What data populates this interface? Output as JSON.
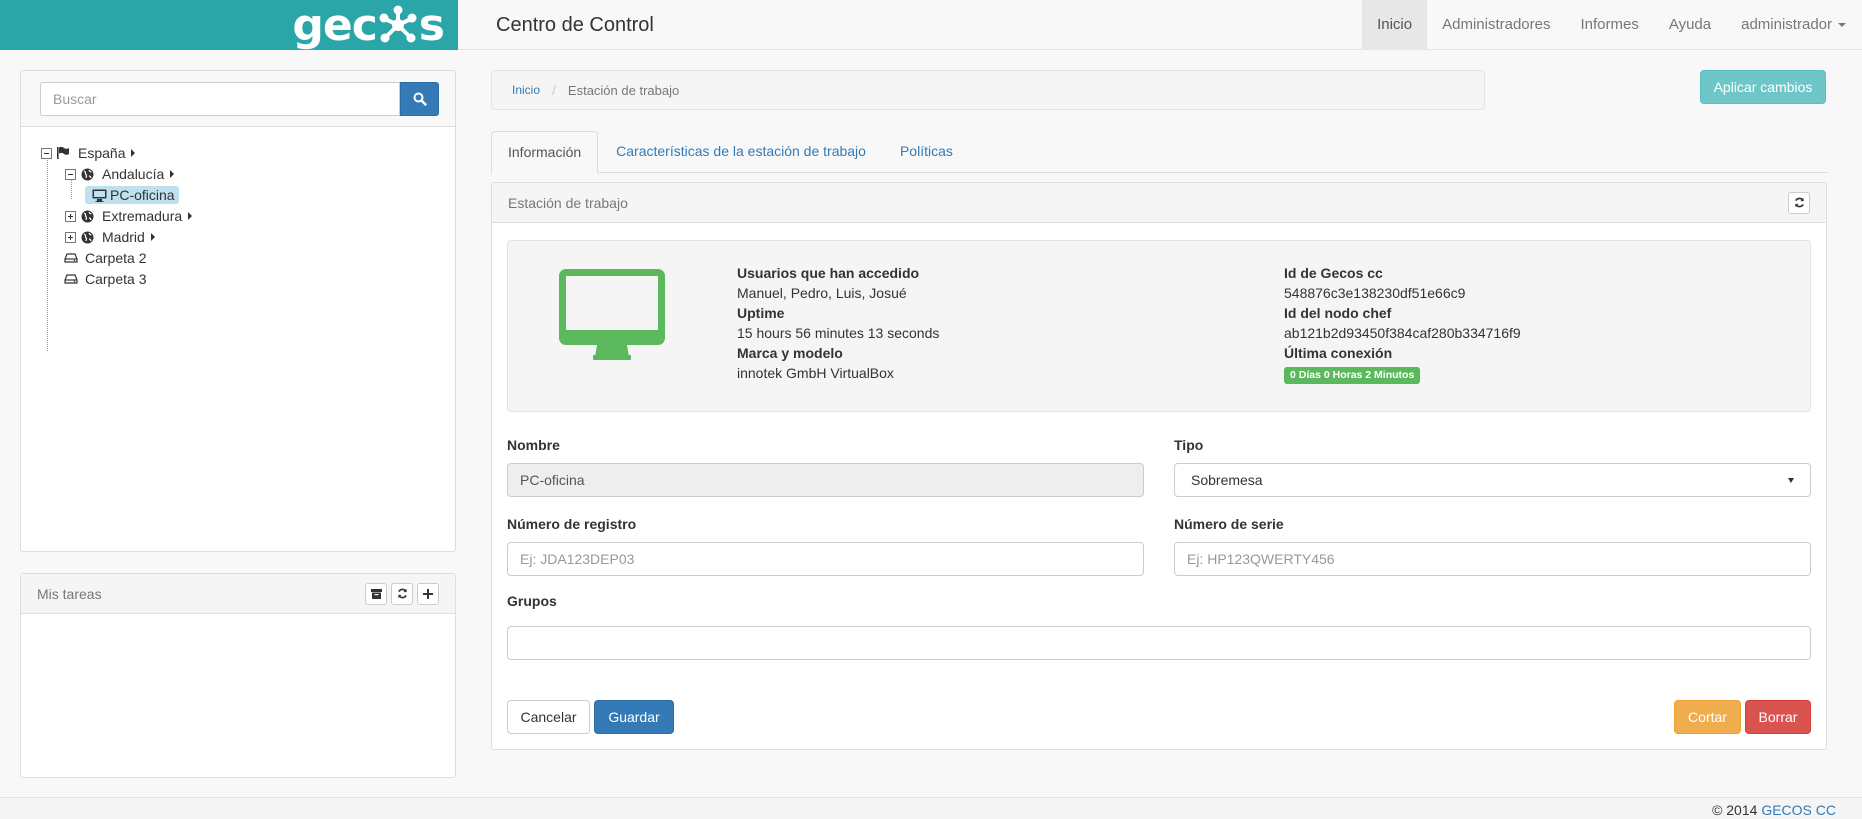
{
  "brand": {
    "logo_text": "gecos"
  },
  "header": {
    "title": "Centro de Control",
    "nav": [
      {
        "label": "Inicio",
        "active": true
      },
      {
        "label": "Administradores"
      },
      {
        "label": "Informes"
      },
      {
        "label": "Ayuda"
      },
      {
        "label": "administrador",
        "dropdown": true
      }
    ]
  },
  "search": {
    "placeholder": "Buscar"
  },
  "tree": {
    "items": [
      {
        "label": "España",
        "icon": "flag-icon",
        "expanded": true
      },
      {
        "label": "Andalucía",
        "icon": "globe-icon",
        "expanded": true
      },
      {
        "label": "PC-oficina",
        "icon": "desktop-icon",
        "selected": true
      },
      {
        "label": "Extremadura",
        "icon": "globe-icon",
        "expanded": false
      },
      {
        "label": "Madrid",
        "icon": "globe-icon",
        "expanded": false
      },
      {
        "label": "Carpeta 2",
        "icon": "hdd-icon"
      },
      {
        "label": "Carpeta 3",
        "icon": "hdd-icon"
      }
    ]
  },
  "tasks": {
    "title": "Mis tareas"
  },
  "breadcrumb": {
    "home": "Inicio",
    "current": "Estación de trabajo"
  },
  "apply_button": "Aplicar cambios",
  "tabs": [
    {
      "label": "Información",
      "active": true
    },
    {
      "label": "Características de la estación de trabajo"
    },
    {
      "label": "Políticas"
    }
  ],
  "panel": {
    "title": "Estación de trabajo"
  },
  "info": {
    "users_label": "Usuarios que han accedido",
    "users_value": "Manuel, Pedro, Luis, Josué",
    "uptime_label": "Uptime",
    "uptime_value": "15 hours 56 minutes 13 seconds",
    "model_label": "Marca y modelo",
    "model_value": "innotek GmbH VirtualBox",
    "gecos_id_label": "Id de Gecos cc",
    "gecos_id_value": "548876c3e138230df51e66c9",
    "chef_id_label": "Id del nodo chef",
    "chef_id_value": "ab121b2d93450f384caf280b334716f9",
    "last_conn_label": "Última conexión",
    "last_conn_value": "0 Días 0 Horas 2 Minutos",
    "status_color": "#5cb85c"
  },
  "form": {
    "name_label": "Nombre",
    "name_value": "PC-oficina",
    "type_label": "Tipo",
    "type_value": "Sobremesa",
    "registry_label": "Número de registro",
    "registry_placeholder": "Ej: JDA123DEP03",
    "serial_label": "Número de serie",
    "serial_placeholder": "Ej: HP123QWERTY456",
    "groups_label": "Grupos",
    "groups_value": ""
  },
  "actions": {
    "cancel": "Cancelar",
    "save": "Guardar",
    "cut": "Cortar",
    "delete": "Borrar"
  },
  "footer": {
    "copyright": "© 2014",
    "link": "GECOS CC"
  },
  "colors": {
    "brand": "#2ba6a8",
    "primary": "#337ab7",
    "success": "#5cb85c",
    "warning": "#f0ad4e",
    "danger": "#d9534f"
  }
}
